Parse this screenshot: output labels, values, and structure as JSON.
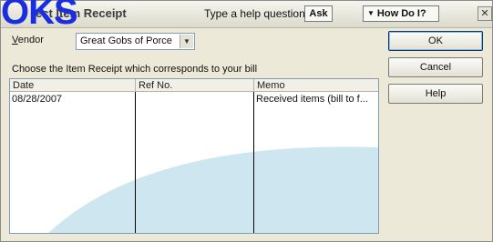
{
  "window": {
    "title": "Select Item Receipt",
    "title_visible_fragment": "ect Item Receipt",
    "watermark": "OKS",
    "help_label": "Type a help question",
    "ask_label": "Ask",
    "how_do_i_label": "How Do I?",
    "close_glyph": "✕"
  },
  "vendor": {
    "label_u": "V",
    "label_rest": "endor",
    "value": "Great Gobs of Porce"
  },
  "instruction": "Choose the Item Receipt which corresponds to your bill",
  "table": {
    "columns": [
      "Date",
      "Ref No.",
      "Memo"
    ],
    "rows": [
      {
        "date": "08/28/2007",
        "ref_no": "",
        "memo": "Received items (bill to f..."
      }
    ]
  },
  "buttons": {
    "ok": "OK",
    "cancel": "Cancel",
    "help": "Help"
  },
  "colors": {
    "watermark": "#1a2ee0",
    "swoosh": "#cde6ef"
  }
}
